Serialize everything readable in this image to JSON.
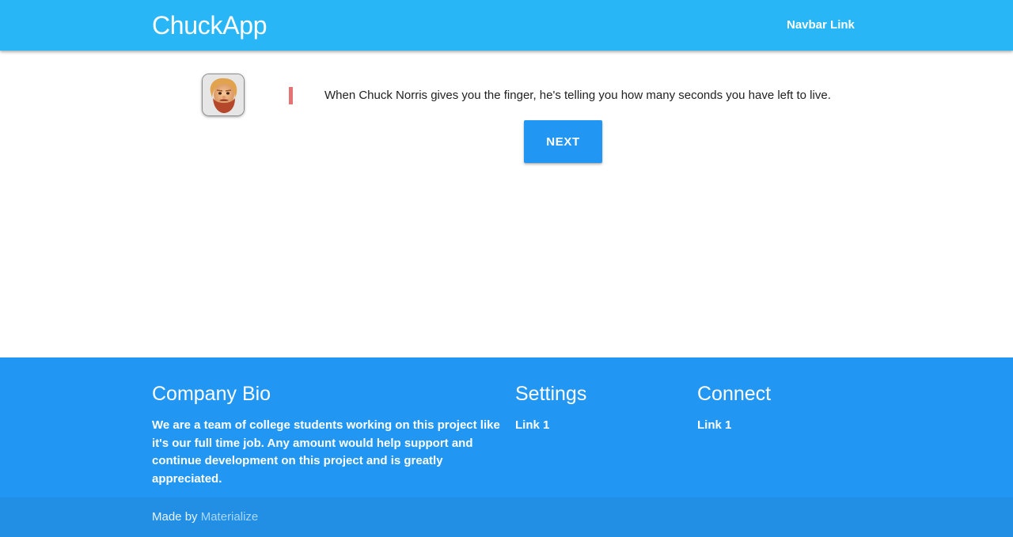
{
  "navbar": {
    "brand": "ChuckApp",
    "link": "Navbar Link",
    "color": "#29b6f6"
  },
  "main": {
    "avatar_icon": "chuck-norris-avatar-icon",
    "joke": "When Chuck Norris gives you the finger, he's telling you how many seconds you have left to live.",
    "quote_bar_color": "#e57373",
    "next_label": "Next"
  },
  "footer": {
    "color": "#2196f3",
    "bio": {
      "title": "Company Bio",
      "text": "We are a team of college students working on this project like it's our full time job. Any amount would help support and continue development on this project and is greatly appreciated."
    },
    "settings": {
      "title": "Settings",
      "link": "Link 1"
    },
    "connect": {
      "title": "Connect",
      "link": "Link 1"
    },
    "copyright": {
      "prefix": "Made by",
      "link": "Materialize"
    }
  }
}
